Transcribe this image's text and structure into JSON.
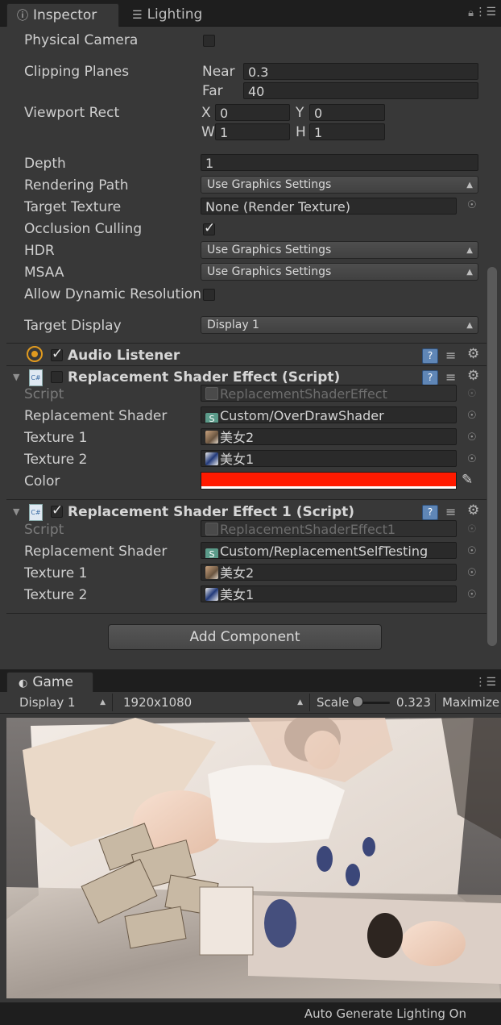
{
  "tabs": {
    "inspector": "Inspector",
    "lighting": "Lighting"
  },
  "camera": {
    "physical_camera": "Physical Camera",
    "clipping_planes": "Clipping Planes",
    "near_label": "Near",
    "near_value": "0.3",
    "far_label": "Far",
    "far_value": "40",
    "viewport_rect": "Viewport Rect",
    "x_label": "X",
    "x_value": "0",
    "y_label": "Y",
    "y_value": "0",
    "w_label": "W",
    "w_value": "1",
    "h_label": "H",
    "h_value": "1",
    "depth": "Depth",
    "depth_value": "1",
    "rendering_path": "Rendering Path",
    "rendering_path_value": "Use Graphics Settings",
    "target_texture": "Target Texture",
    "target_texture_value": "None (Render Texture)",
    "occlusion_culling": "Occlusion Culling",
    "hdr": "HDR",
    "hdr_value": "Use Graphics Settings",
    "msaa": "MSAA",
    "msaa_value": "Use Graphics Settings",
    "allow_dynamic_resolution": "Allow Dynamic Resolution",
    "target_display": "Target Display",
    "target_display_value": "Display 1"
  },
  "audio_listener": {
    "title": "Audio Listener",
    "enabled": true
  },
  "component1": {
    "title": "Replacement Shader Effect (Script)",
    "enabled": false,
    "script_label": "Script",
    "script_value": "ReplacementShaderEffect",
    "shader_label": "Replacement Shader",
    "shader_value": "Custom/OverDrawShader",
    "tex1_label": "Texture 1",
    "tex1_value": "美女2",
    "tex2_label": "Texture 2",
    "tex2_value": "美女1",
    "color_label": "Color",
    "color_value": "#ff1a00"
  },
  "component2": {
    "title": "Replacement Shader Effect 1 (Script)",
    "enabled": true,
    "script_label": "Script",
    "script_value": "ReplacementShaderEffect1",
    "shader_label": "Replacement Shader",
    "shader_value": "Custom/ReplacementSelfTesting",
    "tex1_label": "Texture 1",
    "tex1_value": "美女2",
    "tex2_label": "Texture 2",
    "tex2_value": "美女1"
  },
  "add_component": "Add Component",
  "game": {
    "tab": "Game",
    "display": "Display 1",
    "resolution": "1920x1080",
    "scale_label": "Scale",
    "scale_value": "0.323",
    "maximize": "Maximize O"
  },
  "status": "Auto Generate Lighting On",
  "colors": {
    "accent": "#ff1a00",
    "panel": "#383838",
    "dark": "#1e1e1e"
  }
}
